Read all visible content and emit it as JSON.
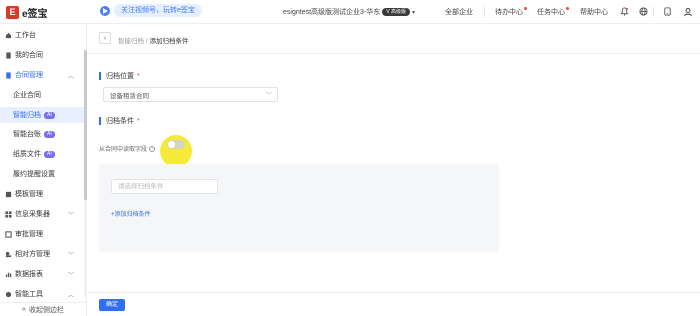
{
  "header": {
    "logo_mark": "E",
    "logo_text": "e签宝",
    "promo_text": "关注视频号，玩转e签宝",
    "org_name": "esigntest高级版测试企业3-华东",
    "org_badge": "V 高级版",
    "nav": {
      "all_enterprises": "全部企业",
      "todo_center": "待办中心",
      "task_center": "任务中心",
      "help_center": "帮助中心"
    },
    "accent_color": "#2f6ef5"
  },
  "sidebar": {
    "items": [
      {
        "label": "工作台"
      },
      {
        "label": "我的合同"
      },
      {
        "label": "合同管理"
      },
      {
        "label": "模板管理"
      },
      {
        "label": "信息采集器"
      },
      {
        "label": "审批管理"
      },
      {
        "label": "相对方管理"
      },
      {
        "label": "数据报表"
      },
      {
        "label": "智能工具"
      }
    ],
    "sub_items": [
      {
        "label": "企业合同"
      },
      {
        "label": "智能归档",
        "tag": "AI"
      },
      {
        "label": "智能台账",
        "tag": "AI"
      },
      {
        "label": "纸质文件",
        "tag": "AI"
      },
      {
        "label": "履约提醒设置"
      }
    ],
    "collapse_label": "收起侧边栏"
  },
  "main": {
    "breadcrumb": {
      "parent": "智能归档",
      "separator": "/",
      "current": "添加归档条件"
    },
    "archive_location": {
      "label": "归档位置",
      "required": "*",
      "value": "设备租赁合同"
    },
    "archive_condition": {
      "label": "归档条件",
      "required": "*",
      "hint": "从合同中读取字段",
      "hint_icon": "?",
      "input_placeholder": "请选择归档条件",
      "add_link": "+添加归档条件"
    },
    "confirm_button": "确定"
  }
}
